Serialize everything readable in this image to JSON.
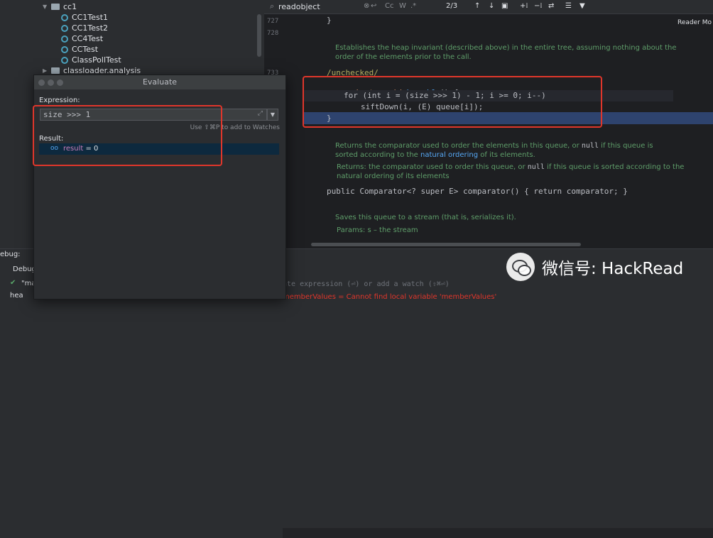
{
  "project_tree": {
    "items": [
      {
        "label": "cc1",
        "type": "folder",
        "indent": 1,
        "expanded": true
      },
      {
        "label": "CC1Test1",
        "type": "class",
        "indent": 2
      },
      {
        "label": "CC1Test2",
        "type": "class",
        "indent": 2
      },
      {
        "label": "CC4Test",
        "type": "class",
        "indent": 2
      },
      {
        "label": "CCTest",
        "type": "class",
        "indent": 2
      },
      {
        "label": "ClassPollTest",
        "type": "class",
        "indent": 2
      },
      {
        "label": "classloader.analysis",
        "type": "folder",
        "indent": 1,
        "expanded": false
      }
    ]
  },
  "find_bar": {
    "query": "readobject",
    "match_count": "2/3",
    "case_label": "Cc",
    "word_label": "W"
  },
  "editor": {
    "reader_mode_label": "Reader Mo",
    "line_numbers": [
      "727",
      "728",
      "733"
    ],
    "line_closing_1": "}",
    "doc_heapify": "Establishes the heap invariant (described above) in the entire tree, assuming nothing about the order of the elements prior to the call.",
    "annotation": "/unchecked/",
    "code_heapify_kw1": "private",
    "code_heapify_kw2": "void",
    "code_heapify_name": "heapify",
    "code_heapify_rest": "() {",
    "code_for_line": "for (int i = (size >>> 1) - 1; i >= 0; i--)",
    "code_sift_line": "siftDown(i, (E) queue[i]);",
    "code_close_brace": "}",
    "doc_comparator_1": "Returns the comparator used to order the elements in this queue, or",
    "doc_comparator_null": "null",
    "doc_comparator_2": "if this queue is sorted according to the",
    "doc_comparator_link": "natural ordering",
    "doc_comparator_3": "of its elements.",
    "doc_returns_label": "Returns:",
    "doc_returns_1": "the comparator used to order this queue, or",
    "doc_returns_null": "null",
    "doc_returns_2": "if this queue is sorted according to the natural ordering of its elements",
    "code_comparator_line": "public Comparator<? super E> comparator() { return comparator; }",
    "doc_writeobject": "Saves this queue to a stream (that is, serializes it).",
    "doc_params_label": "Params:",
    "doc_params_value": "s – the stream"
  },
  "evaluate_dialog": {
    "title": "Evaluate",
    "expression_label": "Expression:",
    "expression_value": "size >>> 1",
    "watch_hint": "Use ⇧⌘P to add to Watches",
    "result_label": "Result:",
    "result_name": "result",
    "result_value": "= 0"
  },
  "bottom_panel": {
    "debug_label": "ebug:",
    "debugger_tab": "Debug",
    "frame_text": "\"ma",
    "frame_text_2": "hea",
    "watch_placeholder": "ate expression (⏎) or add a watch (⇧⌘⏎)",
    "error_text": "memberValues = Cannot find local variable 'memberValues'"
  },
  "watermark": {
    "text": "微信号: HackRead"
  },
  "colors": {
    "annotation_red": "#e0362b",
    "selection_blue": "#2e436e",
    "result_row": "#0d293e"
  }
}
